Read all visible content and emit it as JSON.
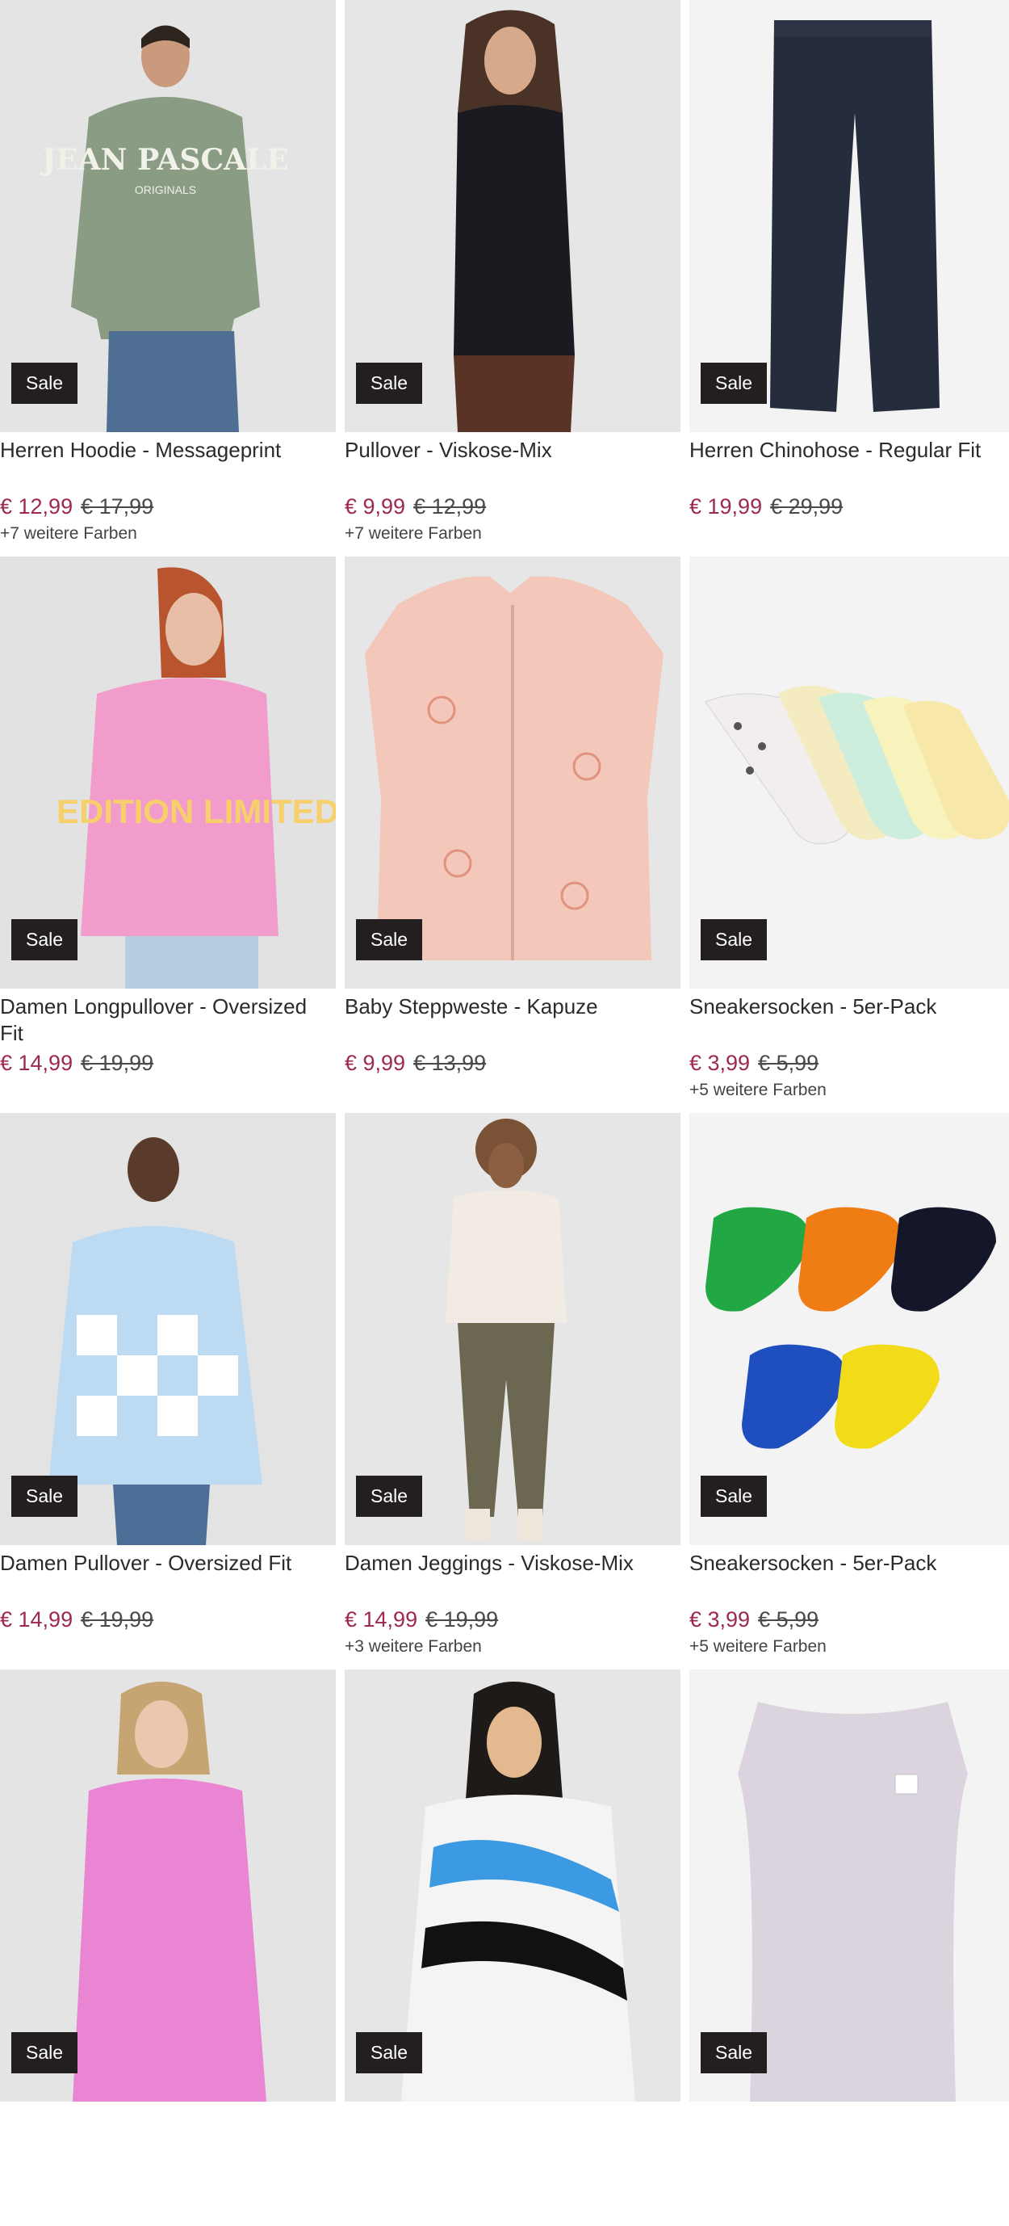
{
  "products": [
    {
      "title": "Herren Hoodie - Messageprint",
      "badge": "Sale",
      "price_new": "€ 12,99",
      "price_old": "€ 17,99",
      "colors": "+7 weitere Farben"
    },
    {
      "title": "Pullover - Viskose-Mix",
      "badge": "Sale",
      "price_new": "€ 9,99",
      "price_old": "€ 12,99",
      "colors": "+7 weitere Farben"
    },
    {
      "title": "Herren Chinohose - Regular Fit",
      "badge": "Sale",
      "price_new": "€ 19,99",
      "price_old": "€ 29,99",
      "colors": ""
    },
    {
      "title": "Damen Longpullover - Oversized Fit",
      "badge": "Sale",
      "price_new": "€ 14,99",
      "price_old": "€ 19,99",
      "colors": ""
    },
    {
      "title": "Baby Steppweste - Kapuze",
      "badge": "Sale",
      "price_new": "€ 9,99",
      "price_old": "€ 13,99",
      "colors": ""
    },
    {
      "title": "Sneakersocken - 5er-Pack",
      "badge": "Sale",
      "price_new": "€ 3,99",
      "price_old": "€ 5,99",
      "colors": "+5 weitere Farben"
    },
    {
      "title": "Damen Pullover - Oversized Fit",
      "badge": "Sale",
      "price_new": "€ 14,99",
      "price_old": "€ 19,99",
      "colors": ""
    },
    {
      "title": "Damen Jeggings - Viskose-Mix",
      "badge": "Sale",
      "price_new": "€ 14,99",
      "price_old": "€ 19,99",
      "colors": "+3 weitere Farben"
    },
    {
      "title": "Sneakersocken - 5er-Pack",
      "badge": "Sale",
      "price_new": "€ 3,99",
      "price_old": "€ 5,99",
      "colors": "+5 weitere Farben"
    },
    {
      "badge": "Sale"
    },
    {
      "badge": "Sale"
    },
    {
      "badge": "Sale"
    }
  ],
  "image_text": {
    "hoodie_print": "JEAN PASCALE",
    "hoodie_print_sub": "ORIGINALS",
    "longpullover_print": "EDITION LIMITED"
  },
  "colors": {
    "price_sale": "#9d2a4d",
    "badge_bg": "#231f20",
    "badge_text": "#ffffff"
  }
}
